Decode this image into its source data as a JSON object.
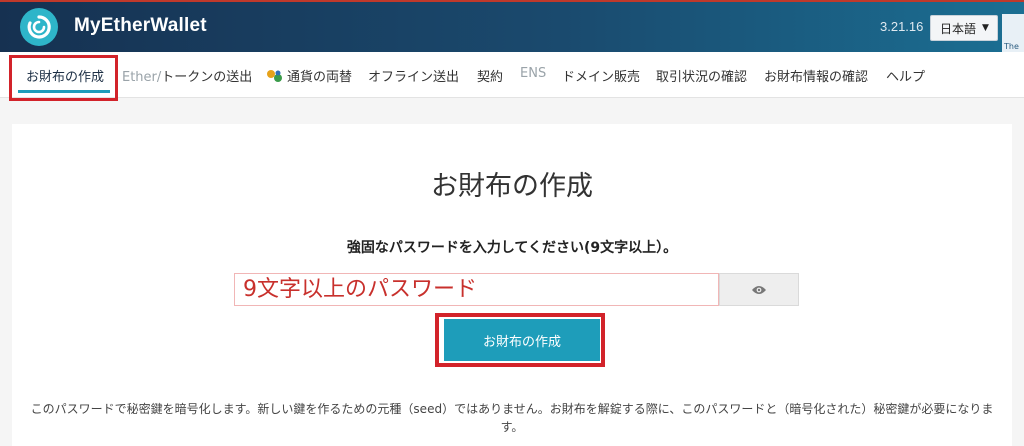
{
  "header": {
    "brand": "MyEtherWallet",
    "version": "3.21.16",
    "language": "日本語",
    "corner_text": "The"
  },
  "nav": {
    "items": [
      {
        "label": "お財布の作成",
        "state": "active"
      },
      {
        "label": "Ether/トークンの送出",
        "state": "normal"
      },
      {
        "label": "通貨の両替",
        "state": "normal",
        "icon": "swap-icon"
      },
      {
        "label": "オフライン送出",
        "state": "normal"
      },
      {
        "label": "契約",
        "state": "normal"
      },
      {
        "label": "ENS",
        "state": "muted"
      },
      {
        "label": "ドメイン販売",
        "state": "normal"
      },
      {
        "label": "取引状況の確認",
        "state": "normal"
      },
      {
        "label": "お財布情報の確認",
        "state": "normal"
      },
      {
        "label": "ヘルプ",
        "state": "normal"
      }
    ]
  },
  "main": {
    "title": "お財布の作成",
    "password_prompt": "強固なパスワードを入力してください(9文字以上）。",
    "password_value": "9文字以上のパスワード",
    "create_button": "お財布の作成",
    "note": "このパスワードで秘密鍵を暗号化します。新しい鍵を作るための元種（seed）ではありません。お財布を解錠する際に、このパスワードと（暗号化された）秘密鍵が必要になります。"
  },
  "colors": {
    "accent": "#1e9dba",
    "highlight": "#d2232a",
    "header_dark": "#163151"
  }
}
